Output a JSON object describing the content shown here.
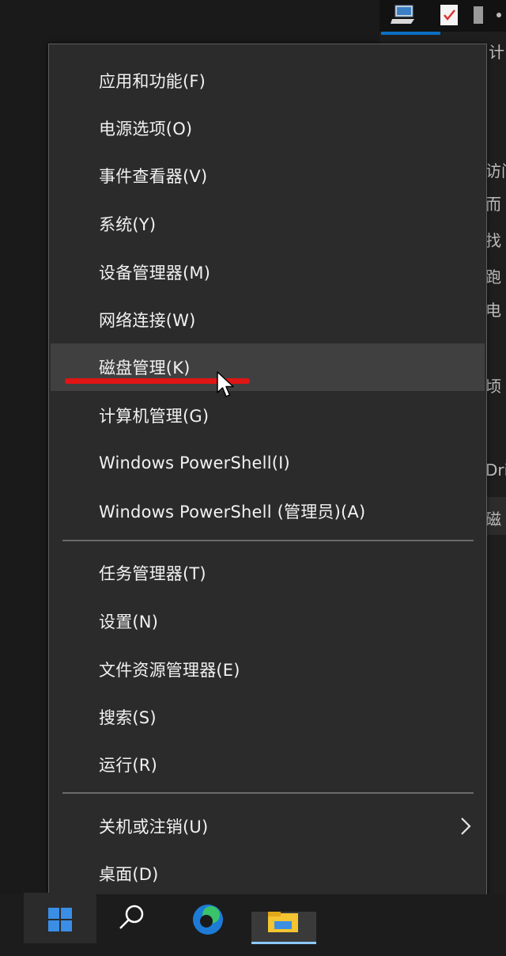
{
  "menu": {
    "group1": [
      {
        "label": "应用和功能(F)"
      },
      {
        "label": "电源选项(O)"
      },
      {
        "label": "事件查看器(V)"
      },
      {
        "label": "系统(Y)"
      },
      {
        "label": "设备管理器(M)"
      },
      {
        "label": "网络连接(W)"
      },
      {
        "label": "磁盘管理(K)",
        "state": "hover"
      },
      {
        "label": "计算机管理(G)"
      },
      {
        "label": "Windows PowerShell(I)"
      },
      {
        "label": "Windows PowerShell (管理员)(A)"
      }
    ],
    "group2": [
      {
        "label": "任务管理器(T)"
      },
      {
        "label": "设置(N)"
      },
      {
        "label": "文件资源管理器(E)"
      },
      {
        "label": "搜索(S)"
      },
      {
        "label": "运行(R)"
      }
    ],
    "group3": [
      {
        "label": "关机或注销(U)",
        "submenu_icon": "chevron-right-icon"
      },
      {
        "label": "桌面(D)"
      }
    ]
  },
  "background_window": {
    "fragments": [
      "计",
      "访问",
      "而",
      "找",
      "跑",
      "电",
      "顷",
      "Dri",
      "磁"
    ]
  },
  "annotation": {
    "color": "#e01515"
  },
  "taskbar": {
    "icons": [
      "windows-start-icon",
      "search-icon",
      "edge-icon",
      "file-explorer-icon"
    ]
  },
  "colors": {
    "menu_background": "#2b2b2b",
    "menu_hover": "#404040",
    "menu_text": "#f2f2f2",
    "separator": "#6a6a6a"
  }
}
